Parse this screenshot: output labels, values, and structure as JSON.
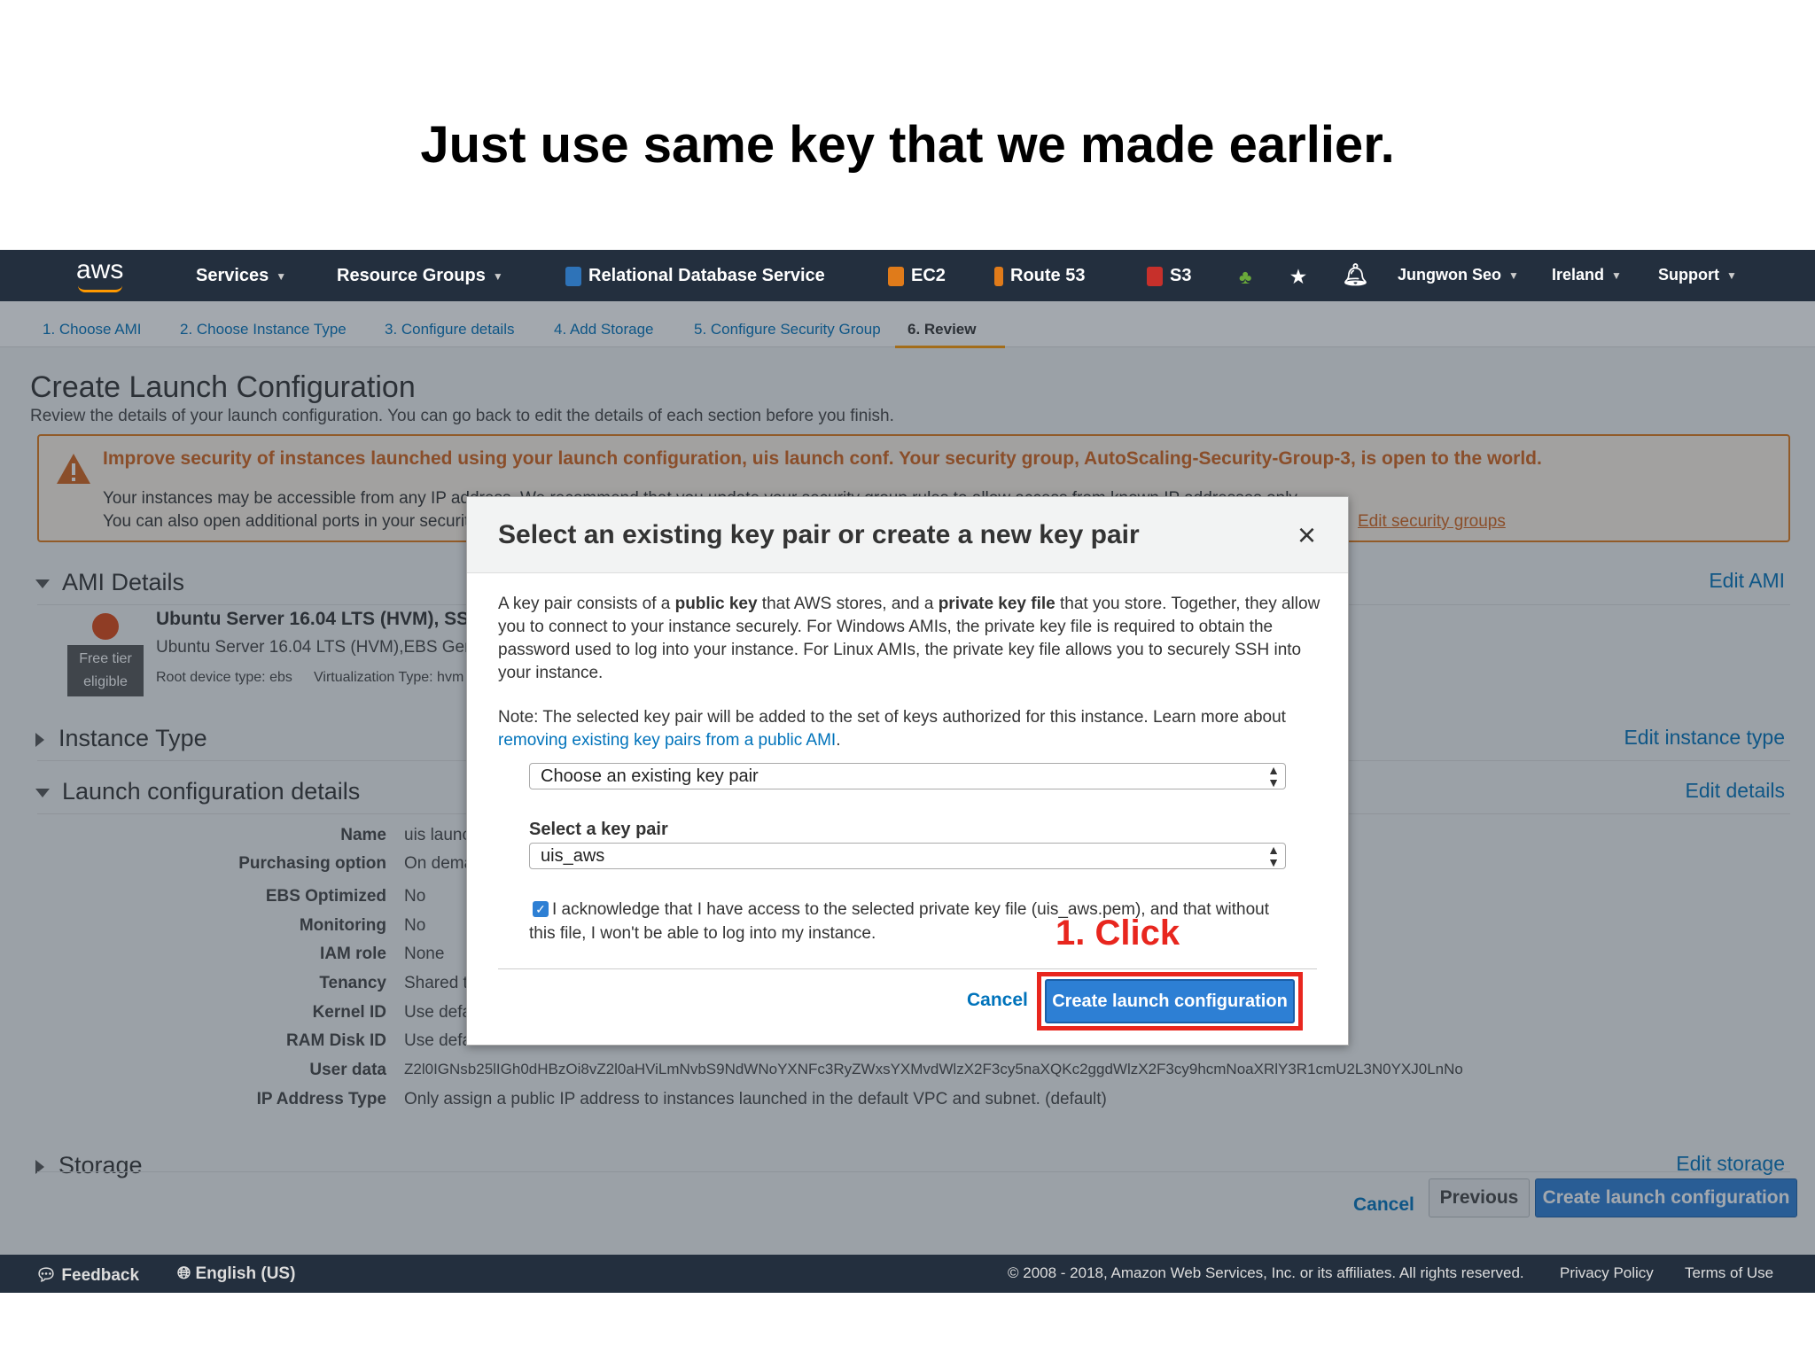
{
  "slide_title": "Just use same key that we made earlier.",
  "nav": {
    "logo": "aws",
    "services": "Services",
    "resource_groups": "Resource Groups",
    "rds": "Relational Database Service",
    "ec2": "EC2",
    "route53": "Route 53",
    "s3": "S3",
    "user": "Jungwon Seo",
    "region": "Ireland",
    "support": "Support"
  },
  "steps": [
    "1. Choose AMI",
    "2. Choose Instance Type",
    "3. Configure details",
    "4. Add Storage",
    "5. Configure Security Group",
    "6. Review"
  ],
  "page": {
    "title": "Create Launch Configuration",
    "subtitle": "Review the details of your launch configuration. You can go back to edit the details of each section before you finish."
  },
  "warning": {
    "title": "Improve security of instances launched using your launch configuration, uis launch conf. Your security group, AutoScaling-Security-Group-3, is open to the world.",
    "line1": "Your instances may be accessible from any IP address. We recommend that you update your security group rules to allow access from known IP addresses only.",
    "line2": "You can also open additional ports in your security group to facilitate access to the application or service you're running, e.g., HTTP (80) for web servers.",
    "link": "Edit security groups"
  },
  "ami": {
    "header": "AMI Details",
    "edit": "Edit AMI",
    "name": "Ubuntu Server 16.04 LTS (HVM), SSD Volume Type",
    "desc": "Ubuntu Server 16.04 LTS (HVM),EBS General Purpose (SSD) Volume Type.",
    "free_tier_1": "Free tier",
    "free_tier_2": "eligible",
    "root_device": "Root device type: ebs",
    "virtualization": "Virtualization Type: hvm"
  },
  "instance_type": {
    "header": "Instance Type",
    "edit": "Edit instance type"
  },
  "launch_details": {
    "header": "Launch configuration details",
    "edit": "Edit details",
    "rows": [
      {
        "k": "Name",
        "v": "uis launch conf"
      },
      {
        "k": "Purchasing option",
        "v": "On demand"
      },
      {
        "k": "EBS Optimized",
        "v": "No"
      },
      {
        "k": "Monitoring",
        "v": "No"
      },
      {
        "k": "IAM role",
        "v": "None"
      },
      {
        "k": "Tenancy",
        "v": "Shared tenancy"
      },
      {
        "k": "Kernel ID",
        "v": "Use default"
      },
      {
        "k": "RAM Disk ID",
        "v": "Use default"
      },
      {
        "k": "User data",
        "v": "Z2l0IGNsb25lIGh0dHBzOi8vZ2l0aHViLmNvbS9NdWNoYXNFc3RyZWxsYXMvdWlzX2F3cy5naXQKc2ggdWlzX2F3cy9hcmNoaXRlY3R1cmU2L3N0YXJ0LnNo"
      },
      {
        "k": "IP Address Type",
        "v": "Only assign a public IP address to instances launched in the default VPC and subnet. (default)"
      }
    ]
  },
  "storage": {
    "header": "Storage",
    "edit": "Edit storage"
  },
  "bottom": {
    "cancel": "Cancel",
    "previous": "Previous",
    "create": "Create launch configuration"
  },
  "footer": {
    "feedback": "Feedback",
    "language": "English (US)",
    "copyright": "© 2008 - 2018, Amazon Web Services, Inc. or its affiliates. All rights reserved.",
    "privacy": "Privacy Policy",
    "terms": "Terms of Use"
  },
  "modal": {
    "title": "Select an existing key pair or create a new key pair",
    "close": "×",
    "p1_a": "A key pair consists of a ",
    "p1_b": "public key",
    "p1_c": " that AWS stores, and a ",
    "p1_d": "private key file",
    "p1_e": " that you store. Together, they allow you to connect to your instance securely. For Windows AMIs, the private key file is required to obtain the password used to log into your instance. For Linux AMIs, the private key file allows you to securely SSH into your instance.",
    "p2_a": "Note: The selected key pair will be added to the set of keys authorized for this instance. Learn more about ",
    "p2_link": "removing existing key pairs from a public AMI",
    "p2_end": ".",
    "select1": "Choose an existing key pair",
    "label2": "Select a key pair",
    "select2": "uis_aws",
    "ack": "I acknowledge that I have access to the selected private key file (uis_aws.pem), and that without this file, I won't be able to log into my instance.",
    "cancel": "Cancel",
    "create": "Create launch configuration"
  },
  "annotation": "1. Click"
}
